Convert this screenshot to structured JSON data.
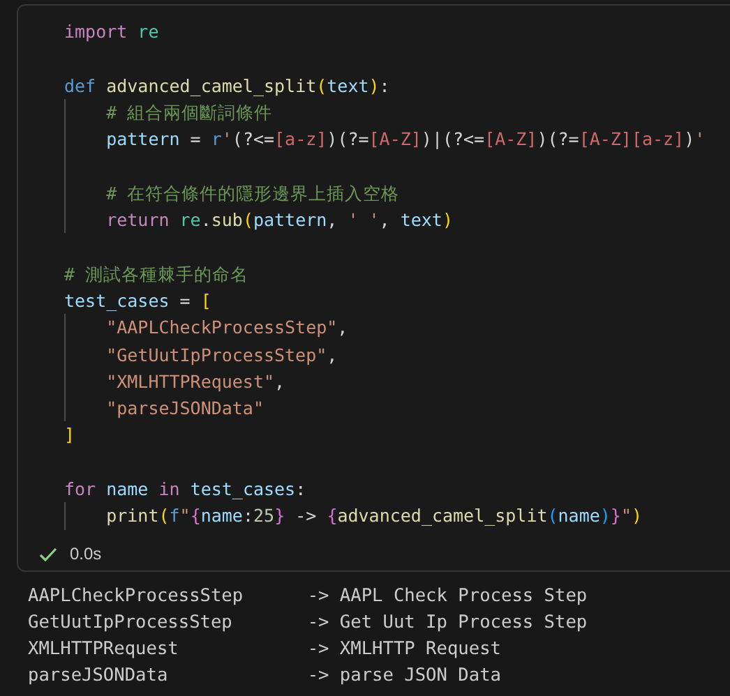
{
  "code_cell": {
    "lines": [
      {
        "indented": false,
        "tokens": [
          {
            "kind": "keyword",
            "text": "import"
          },
          {
            "kind": "module",
            "text": " re"
          }
        ]
      },
      {
        "indented": false
      },
      {
        "indented": false,
        "tokens": [
          {
            "kind": "def",
            "text": "def"
          },
          {
            "kind": "function",
            "text": " advanced_camel_split"
          },
          {
            "kind": "bracket1",
            "text": "("
          },
          {
            "kind": "variable",
            "text": "text"
          },
          {
            "kind": "bracket1",
            "text": ")"
          },
          {
            "kind": "plain",
            "text": ":"
          }
        ]
      },
      {
        "indented": true,
        "tokens": [
          {
            "kind": "comment",
            "text": "# 組合兩個斷詞條件"
          }
        ]
      },
      {
        "indented": true,
        "tokens": [
          {
            "kind": "variable",
            "text": "pattern"
          },
          {
            "kind": "plain",
            "text": " = "
          },
          {
            "kind": "prefix",
            "text": "r"
          },
          {
            "kind": "string",
            "text": "'"
          },
          {
            "kind": "plain",
            "text": "(?<="
          },
          {
            "kind": "regex",
            "text": "[a-z]"
          },
          {
            "kind": "plain",
            "text": ")(?="
          },
          {
            "kind": "regex",
            "text": "[A-Z]"
          },
          {
            "kind": "plain",
            "text": ")|(?<="
          },
          {
            "kind": "regex",
            "text": "[A-Z]"
          },
          {
            "kind": "plain",
            "text": ")(?="
          },
          {
            "kind": "regex",
            "text": "[A-Z][a-z]"
          },
          {
            "kind": "plain",
            "text": ")"
          },
          {
            "kind": "string",
            "text": "'"
          }
        ]
      },
      {
        "indented": true
      },
      {
        "indented": true,
        "tokens": [
          {
            "kind": "comment",
            "text": "# 在符合條件的隱形邊界上插入空格"
          }
        ]
      },
      {
        "indented": true,
        "tokens": [
          {
            "kind": "keyword",
            "text": "return"
          },
          {
            "kind": "module",
            "text": " re"
          },
          {
            "kind": "plain",
            "text": "."
          },
          {
            "kind": "function",
            "text": "sub"
          },
          {
            "kind": "bracket1",
            "text": "("
          },
          {
            "kind": "variable",
            "text": "pattern"
          },
          {
            "kind": "plain",
            "text": ", "
          },
          {
            "kind": "string",
            "text": "' '"
          },
          {
            "kind": "plain",
            "text": ", "
          },
          {
            "kind": "variable",
            "text": "text"
          },
          {
            "kind": "bracket1",
            "text": ")"
          }
        ]
      },
      {
        "indented": false
      },
      {
        "indented": false,
        "tokens": [
          {
            "kind": "comment",
            "text": "# 測試各種棘手的命名"
          }
        ]
      },
      {
        "indented": false,
        "tokens": [
          {
            "kind": "variable",
            "text": "test_cases"
          },
          {
            "kind": "plain",
            "text": " = "
          },
          {
            "kind": "bracket1",
            "text": "["
          }
        ]
      },
      {
        "indented": true,
        "tokens": [
          {
            "kind": "string",
            "text": "\"AAPLCheckProcessStep\""
          },
          {
            "kind": "plain",
            "text": ","
          }
        ]
      },
      {
        "indented": true,
        "tokens": [
          {
            "kind": "string",
            "text": "\"GetUutIpProcessStep\""
          },
          {
            "kind": "plain",
            "text": ","
          }
        ]
      },
      {
        "indented": true,
        "tokens": [
          {
            "kind": "string",
            "text": "\"XMLHTTPRequest\""
          },
          {
            "kind": "plain",
            "text": ","
          }
        ]
      },
      {
        "indented": true,
        "tokens": [
          {
            "kind": "string",
            "text": "\"parseJSONData\""
          }
        ]
      },
      {
        "indented": false,
        "tokens": [
          {
            "kind": "bracket1",
            "text": "]"
          }
        ]
      },
      {
        "indented": false
      },
      {
        "indented": false,
        "tokens": [
          {
            "kind": "keyword",
            "text": "for"
          },
          {
            "kind": "variable",
            "text": " name"
          },
          {
            "kind": "keyword",
            "text": " in"
          },
          {
            "kind": "variable",
            "text": " test_cases"
          },
          {
            "kind": "plain",
            "text": ":"
          }
        ]
      },
      {
        "indented": true,
        "tokens": [
          {
            "kind": "function",
            "text": "print"
          },
          {
            "kind": "bracket1",
            "text": "("
          },
          {
            "kind": "prefix",
            "text": "f"
          },
          {
            "kind": "string",
            "text": "\""
          },
          {
            "kind": "bracket2",
            "text": "{"
          },
          {
            "kind": "variable",
            "text": "name"
          },
          {
            "kind": "plain",
            "text": ":"
          },
          {
            "kind": "number",
            "text": "25"
          },
          {
            "kind": "bracket2",
            "text": "}"
          },
          {
            "kind": "plain",
            "text": " -> "
          },
          {
            "kind": "bracket2",
            "text": "{"
          },
          {
            "kind": "function",
            "text": "advanced_camel_split"
          },
          {
            "kind": "bracket3",
            "text": "("
          },
          {
            "kind": "variable",
            "text": "name"
          },
          {
            "kind": "bracket3",
            "text": ")"
          },
          {
            "kind": "bracket2",
            "text": "}"
          },
          {
            "kind": "string",
            "text": "\""
          },
          {
            "kind": "bracket1",
            "text": ")"
          }
        ]
      }
    ],
    "status": {
      "succeeded": true,
      "duration": "0.0s"
    }
  },
  "output": [
    "AAPLCheckProcessStep      -> AAPL Check Process Step",
    "GetUutIpProcessStep       -> Get Uut Ip Process Step",
    "XMLHTTPRequest            -> XMLHTTP Request",
    "parseJSONData             -> parse JSON Data"
  ]
}
